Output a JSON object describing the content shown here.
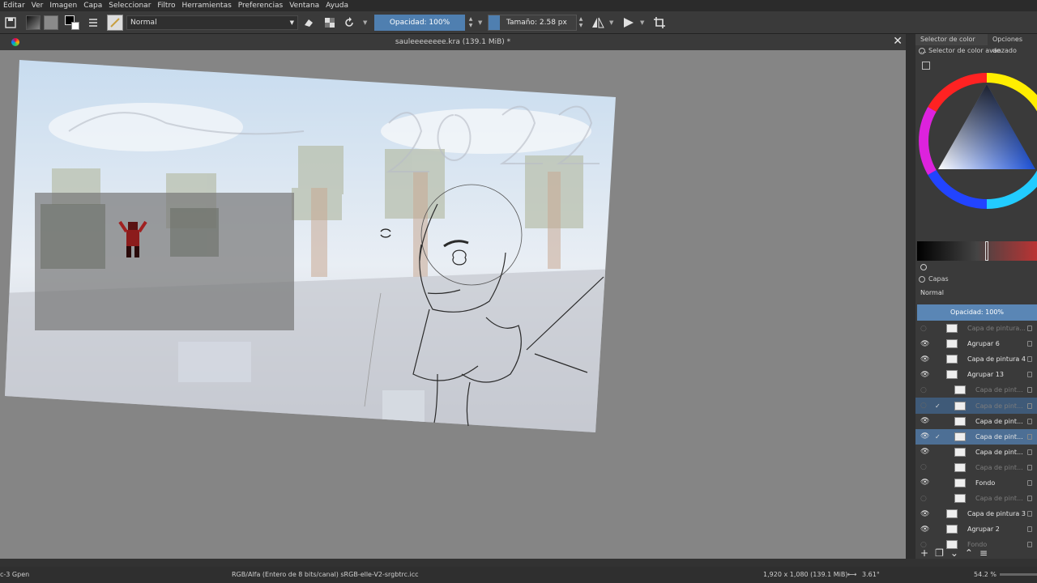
{
  "menu": [
    "Editar",
    "Ver",
    "Imagen",
    "Capa",
    "Seleccionar",
    "Filtro",
    "Herramientas",
    "Preferencias",
    "Ventana",
    "Ayuda"
  ],
  "toolbar": {
    "blend_mode": "Normal",
    "opacity": "Opacidad: 100%",
    "size": "Tamaño: 2.58 px"
  },
  "document": {
    "title": "sauleeeeeeee.kra (139.1 MiB) *"
  },
  "dock": {
    "tabs": [
      "Selector de color ...",
      "Opciones de"
    ],
    "color_panel_title": "Selector de color avanzado",
    "layers_title": "Capas",
    "layers_blend": "Normal",
    "layers_opacity": "Opacidad:  100%",
    "layers": [
      {
        "name": "Capa de pintura...",
        "visible": false,
        "dim": true,
        "indent": 1,
        "state": ""
      },
      {
        "name": "Agrupar 6",
        "visible": true,
        "dim": false,
        "indent": 1,
        "state": ""
      },
      {
        "name": "Capa de pintura 4",
        "visible": true,
        "dim": false,
        "indent": 1,
        "state": ""
      },
      {
        "name": "Agrupar 13",
        "visible": true,
        "dim": false,
        "indent": 1,
        "state": ""
      },
      {
        "name": "Capa de pint...",
        "visible": false,
        "dim": true,
        "indent": 2,
        "state": ""
      },
      {
        "name": "Capa de pint...",
        "visible": false,
        "dim": true,
        "indent": 2,
        "state": "sel2"
      },
      {
        "name": "Capa de pint...",
        "visible": true,
        "dim": false,
        "indent": 2,
        "state": ""
      },
      {
        "name": "Capa de pint...",
        "visible": true,
        "dim": false,
        "indent": 2,
        "state": "sel"
      },
      {
        "name": "Capa de pint...",
        "visible": true,
        "dim": false,
        "indent": 2,
        "state": ""
      },
      {
        "name": "Capa de pint...",
        "visible": false,
        "dim": true,
        "indent": 2,
        "state": ""
      },
      {
        "name": "Fondo",
        "visible": true,
        "dim": false,
        "indent": 2,
        "state": ""
      },
      {
        "name": "Capa de pint...",
        "visible": false,
        "dim": true,
        "indent": 2,
        "state": ""
      },
      {
        "name": "Capa de pintura 3",
        "visible": true,
        "dim": false,
        "indent": 1,
        "state": ""
      },
      {
        "name": "Agrupar 2",
        "visible": true,
        "dim": false,
        "indent": 1,
        "state": ""
      },
      {
        "name": "Fondo",
        "visible": false,
        "dim": true,
        "indent": 1,
        "state": ""
      }
    ]
  },
  "status": {
    "brush": "c-3 Gpen",
    "color_space": "RGB/Alfa (Entero de 8 bits/canal)  sRGB-elle-V2-srgbtrc.icc",
    "dimensions": "1,920 x 1,080 (139.1 MiB)",
    "rotation": "3.61°",
    "zoom": "54.2 %"
  }
}
